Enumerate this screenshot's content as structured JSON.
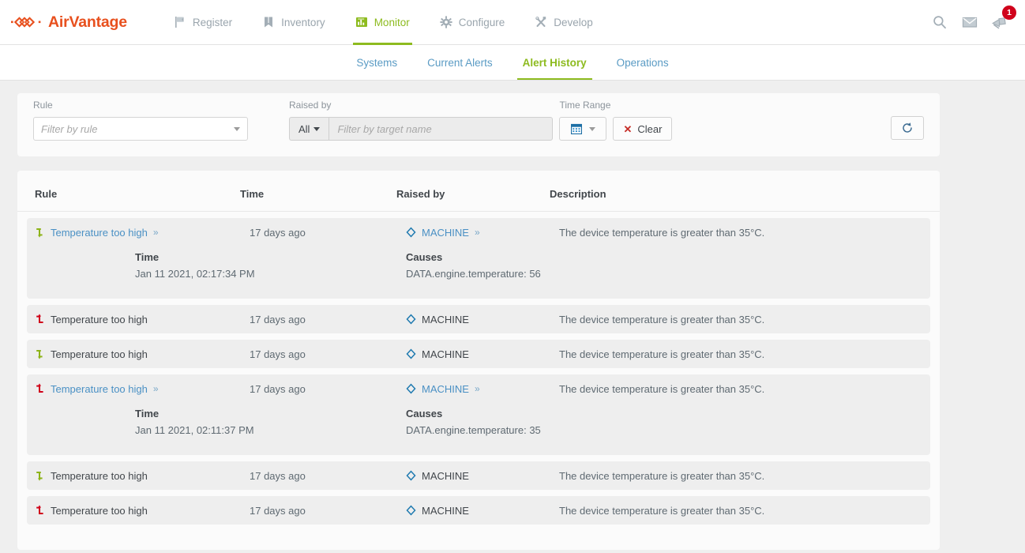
{
  "brand": {
    "name": "AirVantage",
    "logo_icon": "airvantage-chevron-logo",
    "color": "#e8501e"
  },
  "topnav": {
    "items": [
      {
        "label": "Register",
        "icon": "flag-icon",
        "active": false
      },
      {
        "label": "Inventory",
        "icon": "book-icon",
        "active": false
      },
      {
        "label": "Monitor",
        "icon": "dashboard-icon",
        "active": true
      },
      {
        "label": "Configure",
        "icon": "gear-icon",
        "active": false
      },
      {
        "label": "Develop",
        "icon": "tools-icon",
        "active": false
      }
    ],
    "tools": [
      {
        "name": "search-icon"
      },
      {
        "name": "mail-icon"
      },
      {
        "name": "announcement-icon",
        "badge": "1",
        "badge_color": "#d0021b"
      }
    ],
    "active_color": "#8dbb1f"
  },
  "subtabs": {
    "items": [
      {
        "label": "Systems",
        "active": false
      },
      {
        "label": "Current Alerts",
        "active": false
      },
      {
        "label": "Alert History",
        "active": true
      },
      {
        "label": "Operations",
        "active": false
      }
    ]
  },
  "filters": {
    "rule": {
      "label": "Rule",
      "placeholder": "Filter by rule",
      "value": ""
    },
    "raised_by": {
      "label": "Raised by",
      "scope_value": "All",
      "placeholder": "Filter by target name",
      "value": ""
    },
    "time_range": {
      "label": "Time Range",
      "calendar_icon": "calendar-icon",
      "clear_label": "Clear",
      "clear_icon": "x-icon"
    },
    "refresh": {
      "icon": "refresh-icon",
      "title": "Refresh"
    }
  },
  "table": {
    "columns": {
      "rule": "Rule",
      "time": "Time",
      "raised_by": "Raised by",
      "description": "Description"
    },
    "detail_labels": {
      "time": "Time",
      "causes": "Causes"
    },
    "rows": [
      {
        "icon": "alert-cleared-icon",
        "icon_color": "#8db318",
        "rule": "Temperature too high",
        "rule_link": true,
        "rule_chevron": "»",
        "time": "17 days ago",
        "raised_by": "MACHINE",
        "raised_by_link": true,
        "raised_by_chevron": "»",
        "raised_by_icon": "diamond-icon",
        "description": "The device temperature is greater than 35°C.",
        "expanded": true,
        "detail_time": "Jan 11 2021, 02:17:34 PM",
        "detail_causes": "DATA.engine.temperature: 56"
      },
      {
        "icon": "alert-raised-icon",
        "icon_color": "#d0021b",
        "rule": "Temperature too high",
        "rule_link": false,
        "rule_chevron": "",
        "time": "17 days ago",
        "raised_by": "MACHINE",
        "raised_by_link": false,
        "raised_by_chevron": "",
        "raised_by_icon": "diamond-icon",
        "description": "The device temperature is greater than 35°C.",
        "expanded": false,
        "detail_time": "",
        "detail_causes": ""
      },
      {
        "icon": "alert-cleared-icon",
        "icon_color": "#8db318",
        "rule": "Temperature too high",
        "rule_link": false,
        "rule_chevron": "",
        "time": "17 days ago",
        "raised_by": "MACHINE",
        "raised_by_link": false,
        "raised_by_chevron": "",
        "raised_by_icon": "diamond-icon",
        "description": "The device temperature is greater than 35°C.",
        "expanded": false,
        "detail_time": "",
        "detail_causes": ""
      },
      {
        "icon": "alert-raised-icon",
        "icon_color": "#d0021b",
        "rule": "Temperature too high",
        "rule_link": true,
        "rule_chevron": "»",
        "time": "17 days ago",
        "raised_by": "MACHINE",
        "raised_by_link": true,
        "raised_by_chevron": "»",
        "raised_by_icon": "diamond-icon",
        "description": "The device temperature is greater than 35°C.",
        "expanded": true,
        "detail_time": "Jan 11 2021, 02:11:37 PM",
        "detail_causes": "DATA.engine.temperature: 35"
      },
      {
        "icon": "alert-cleared-icon",
        "icon_color": "#8db318",
        "rule": "Temperature too high",
        "rule_link": false,
        "rule_chevron": "",
        "time": "17 days ago",
        "raised_by": "MACHINE",
        "raised_by_link": false,
        "raised_by_chevron": "",
        "raised_by_icon": "diamond-icon",
        "description": "The device temperature is greater than 35°C.",
        "expanded": false,
        "detail_time": "",
        "detail_causes": ""
      },
      {
        "icon": "alert-raised-icon",
        "icon_color": "#d0021b",
        "rule": "Temperature too high",
        "rule_link": false,
        "rule_chevron": "",
        "time": "17 days ago",
        "raised_by": "MACHINE",
        "raised_by_link": false,
        "raised_by_chevron": "",
        "raised_by_icon": "diamond-icon",
        "description": "The device temperature is greater than 35°C.",
        "expanded": false,
        "detail_time": "",
        "detail_causes": ""
      }
    ]
  }
}
